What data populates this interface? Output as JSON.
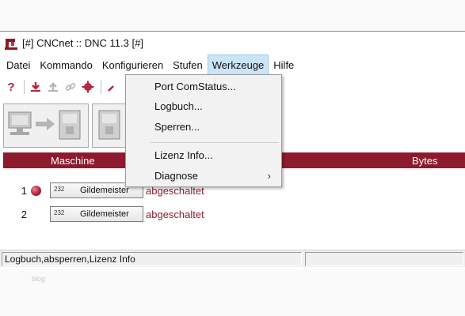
{
  "window": {
    "title": "[#] CNCnet :: DNC 11.3 [#]",
    "app_icon": "cnc-machine-icon"
  },
  "menubar": {
    "items": [
      "Datei",
      "Kommando",
      "Konfigurieren",
      "Stufen",
      "Werkzeuge",
      "Hilfe"
    ],
    "active": "Werkzeuge"
  },
  "toolbar": {
    "icons": [
      "help-icon",
      "download-icon",
      "upload-icon",
      "link-icon",
      "settings-gear-icon",
      "pin-icon"
    ]
  },
  "werkzeuge_menu": {
    "items": [
      {
        "label": "Port ComStatus..."
      },
      {
        "label": "Logbuch..."
      },
      {
        "label": "Sperren..."
      },
      {
        "label": "Lizenz Info..."
      },
      {
        "label": "Diagnose",
        "submenu_arrow": "›"
      }
    ]
  },
  "grid": {
    "columns": {
      "machine": "Maschine",
      "bytes": "Bytes"
    },
    "rows": [
      {
        "num": "1",
        "port": "232",
        "machine": "Gildemeister",
        "status": "abgeschaltet",
        "indicator": "red"
      },
      {
        "num": "2",
        "port": "232",
        "machine": "Gildemeister",
        "status": "abgeschaltet"
      }
    ]
  },
  "statusbar": {
    "text": "Logbuch,absperren,Lizenz Info"
  },
  "background": {
    "faded_text": "blog"
  },
  "colors": {
    "accent": "#8e1a2e",
    "menu_highlight": "#cce4f7"
  }
}
